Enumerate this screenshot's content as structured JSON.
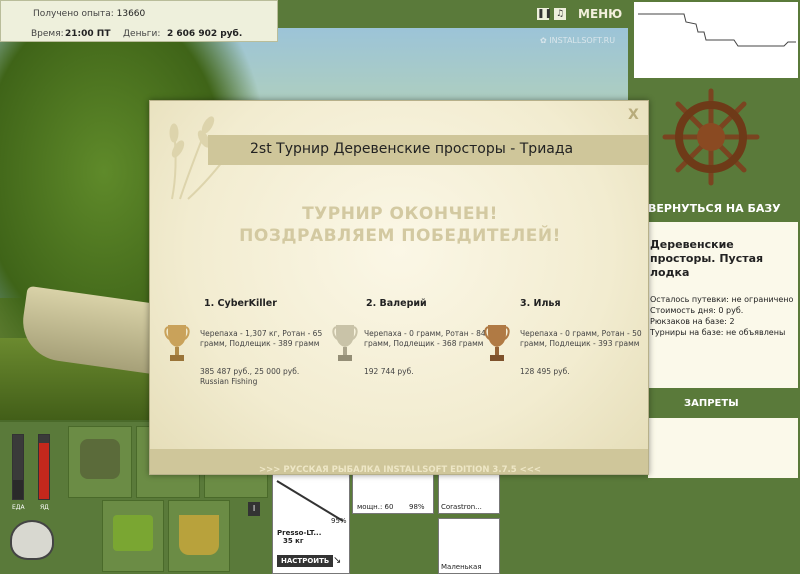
{
  "info": {
    "experience_label": "Получено опыта:",
    "experience_value": "13660",
    "time_label": "Время:",
    "time_value": "21:00 ПТ",
    "money_label": "Деньги:",
    "money_value": "2 606 902 руб."
  },
  "topbar": {
    "pause_icon": "pause-icon",
    "music_icon": "music-icon",
    "menu_label": "МЕНЮ"
  },
  "watermark": "INSTALLSOFT.RU",
  "right_panel": {
    "return_label": "ВЕРНУТЬСЯ НА БАЗУ",
    "location_title": "Деревенские просторы. Пустая лодка",
    "info_lines": [
      "Осталось путевки: не ограничено",
      "Стоимость дня: 0 руб.",
      "Рюкзаков на базе: 2",
      "Турниры на базе: не объявлены"
    ],
    "bans_label": "ЗАПРЕТЫ"
  },
  "bottom": {
    "food_label": "ЕДА",
    "poison_label": "ЯД",
    "rod_name": "Presso-LT...",
    "rod_weight": "35 кг",
    "setup_button": "НАСТРОИТЬ",
    "percent_1": "95%",
    "reel_power_label": "мощн.: 60",
    "percent_2": "98%",
    "line_name": "Corastron...",
    "hook_name": "Маленькая"
  },
  "modal": {
    "title": "2st Турнир Деревенские просторы - Триада",
    "close_label": "X",
    "congrats_line1": "ТУРНИР ОКОНЧЕН!",
    "congrats_line2": "ПОЗДРАВЛЯЕМ ПОБЕДИТЕЛЕЙ!",
    "winners": [
      {
        "name": "1. CyberKiller",
        "catch": "Черепаха - 1,307 кг, Ротан - 65 грамм, Подлещик - 389 грамм",
        "prize": "385 487 руб., 25 000 руб. Russian Fishing"
      },
      {
        "name": "2. Валерий",
        "catch": "Черепаха - 0 грамм, Ротан - 84 грамм, Подлещик - 368 грамм",
        "prize": "192 744 руб."
      },
      {
        "name": "3. Илья",
        "catch": "Черепаха - 0 грамм, Ротан - 50 грамм, Подлещик - 393 грамм",
        "prize": "128 495 руб."
      }
    ],
    "footer": ">>> РУССКАЯ РЫБАЛКА INSTALLSOFT EDITION 3.7.5 <<<"
  },
  "colors": {
    "frame_green": "#5a7a3a",
    "panel_cream": "#fbf9ea",
    "modal_band": "#cfc69a",
    "gold_cup": "#c9a25a",
    "silver_cup": "#c9c3a8",
    "bronze_cup": "#b07a44"
  }
}
